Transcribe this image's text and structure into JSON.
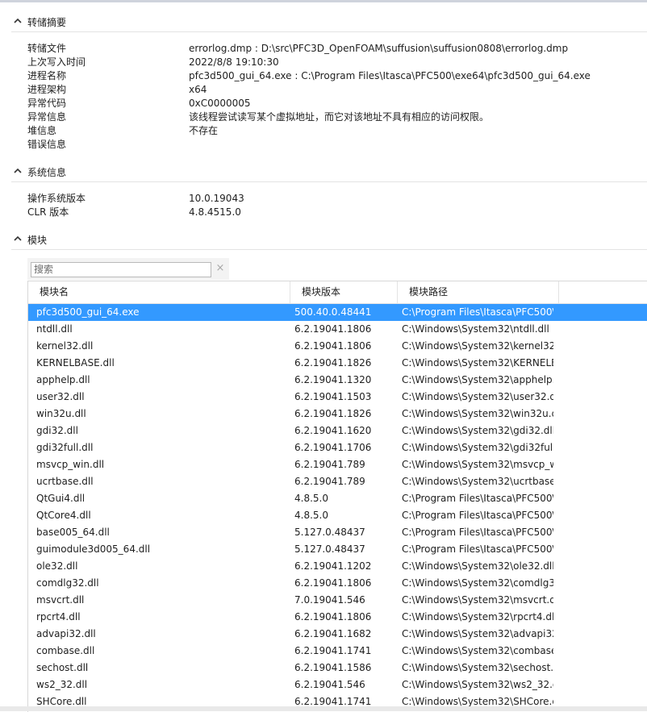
{
  "sections": {
    "dump": {
      "title": "转储摘要",
      "rows": [
        {
          "k": "转储文件",
          "v": "errorlog.dmp : D:\\src\\PFC3D_OpenFOAM\\suffusion\\suffusion0808\\errorlog.dmp"
        },
        {
          "k": "上次写入时间",
          "v": "2022/8/8 19:10:30"
        },
        {
          "k": "进程名称",
          "v": "pfc3d500_gui_64.exe : C:\\Program Files\\Itasca\\PFC500\\exe64\\pfc3d500_gui_64.exe"
        },
        {
          "k": "进程架构",
          "v": "x64"
        },
        {
          "k": "异常代码",
          "v": "0xC0000005"
        },
        {
          "k": "异常信息",
          "v": "该线程尝试读写某个虚拟地址，而它对该地址不具有相应的访问权限。"
        },
        {
          "k": "堆信息",
          "v": "不存在"
        },
        {
          "k": "错误信息",
          "v": ""
        }
      ]
    },
    "system": {
      "title": "系统信息",
      "rows": [
        {
          "k": "操作系统版本",
          "v": "10.0.19043"
        },
        {
          "k": "CLR 版本",
          "v": "4.8.4515.0"
        }
      ]
    },
    "modules": {
      "title": "模块",
      "search_placeholder": "搜索",
      "clear_glyph": "×",
      "columns": [
        "模块名",
        "模块版本",
        "模块路径"
      ],
      "rows": [
        [
          "pfc3d500_gui_64.exe",
          "500.40.0.48441",
          "C:\\Program Files\\Itasca\\PFC500\\"
        ],
        [
          "ntdll.dll",
          "6.2.19041.1806",
          "C:\\Windows\\System32\\ntdll.dll"
        ],
        [
          "kernel32.dll",
          "6.2.19041.1806",
          "C:\\Windows\\System32\\kernel32."
        ],
        [
          "KERNELBASE.dll",
          "6.2.19041.1826",
          "C:\\Windows\\System32\\KERNELB"
        ],
        [
          "apphelp.dll",
          "6.2.19041.1320",
          "C:\\Windows\\System32\\apphelp.d"
        ],
        [
          "user32.dll",
          "6.2.19041.1503",
          "C:\\Windows\\System32\\user32.dl"
        ],
        [
          "win32u.dll",
          "6.2.19041.1826",
          "C:\\Windows\\System32\\win32u.dl"
        ],
        [
          "gdi32.dll",
          "6.2.19041.1620",
          "C:\\Windows\\System32\\gdi32.dll"
        ],
        [
          "gdi32full.dll",
          "6.2.19041.1706",
          "C:\\Windows\\System32\\gdi32full."
        ],
        [
          "msvcp_win.dll",
          "6.2.19041.789",
          "C:\\Windows\\System32\\msvcp_wi"
        ],
        [
          "ucrtbase.dll",
          "6.2.19041.789",
          "C:\\Windows\\System32\\ucrtbase."
        ],
        [
          "QtGui4.dll",
          "4.8.5.0",
          "C:\\Program Files\\Itasca\\PFC500\\"
        ],
        [
          "QtCore4.dll",
          "4.8.5.0",
          "C:\\Program Files\\Itasca\\PFC500\\"
        ],
        [
          "base005_64.dll",
          "5.127.0.48437",
          "C:\\Program Files\\Itasca\\PFC500\\"
        ],
        [
          "guimodule3d005_64.dll",
          "5.127.0.48437",
          "C:\\Program Files\\Itasca\\PFC500\\"
        ],
        [
          "ole32.dll",
          "6.2.19041.1202",
          "C:\\Windows\\System32\\ole32.dll"
        ],
        [
          "comdlg32.dll",
          "6.2.19041.1806",
          "C:\\Windows\\System32\\comdlg32"
        ],
        [
          "msvcrt.dll",
          "7.0.19041.546",
          "C:\\Windows\\System32\\msvcrt.dll"
        ],
        [
          "rpcrt4.dll",
          "6.2.19041.1806",
          "C:\\Windows\\System32\\rpcrt4.dll"
        ],
        [
          "advapi32.dll",
          "6.2.19041.1682",
          "C:\\Windows\\System32\\advapi32"
        ],
        [
          "combase.dll",
          "6.2.19041.1741",
          "C:\\Windows\\System32\\combase"
        ],
        [
          "sechost.dll",
          "6.2.19041.1586",
          "C:\\Windows\\System32\\sechost.d"
        ],
        [
          "ws2_32.dll",
          "6.2.19041.546",
          "C:\\Windows\\System32\\ws2_32.dl"
        ],
        [
          "SHCore.dll",
          "6.2.19041.1741",
          "C:\\Windows\\System32\\SHCore.d"
        ]
      ]
    }
  },
  "colors": {
    "selection": "#3399ff",
    "text": "#1e1e1e"
  }
}
